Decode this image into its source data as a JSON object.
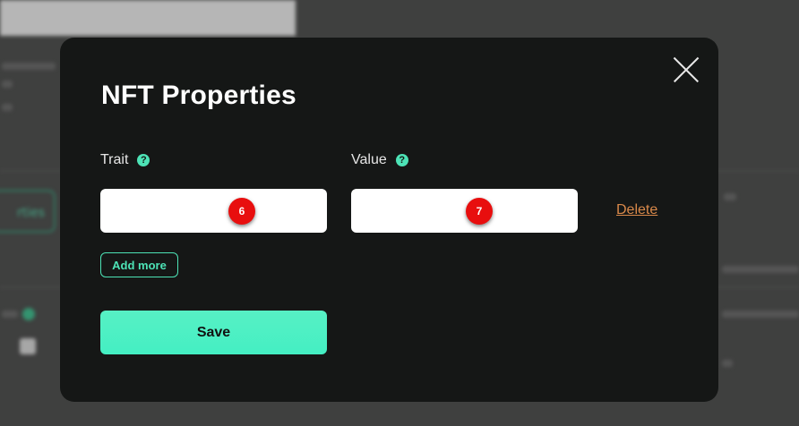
{
  "modal": {
    "title": "NFT Properties",
    "trait_label": "Trait",
    "value_label": "Value",
    "help_glyph": "?",
    "trait_input_value": "",
    "value_input_value": "",
    "trait_marker": "6",
    "value_marker": "7",
    "delete_label": "Delete",
    "add_more_label": "Add more",
    "save_label": "Save"
  },
  "colors": {
    "accent": "#4de3b6",
    "modal_bg": "#151716",
    "delete_link": "#d9894a",
    "marker": "#e80e0e"
  },
  "icons": [
    "close-icon",
    "help-icon"
  ]
}
